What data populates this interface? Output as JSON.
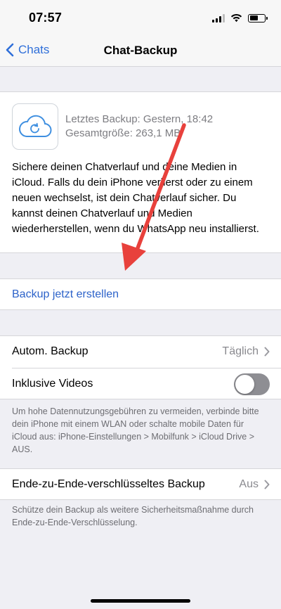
{
  "status": {
    "time": "07:57"
  },
  "nav": {
    "back_label": "Chats",
    "title": "Chat-Backup"
  },
  "backup": {
    "last_backup": "Letztes Backup: Gestern, 18:42",
    "total_size": "Gesamtgröße: 263,1 MB",
    "description": "Sichere deinen Chatverlauf und deine Medien in iCloud. Falls du dein iPhone verlierst oder zu einem neuen wechselst, ist dein Chatverlauf sicher. Du kannst deinen Chatverlauf und Medien wiederherstellen, wenn du WhatsApp neu installierst."
  },
  "action": {
    "backup_now": "Backup jetzt erstellen"
  },
  "settings": {
    "auto_backup_label": "Autom. Backup",
    "auto_backup_value": "Täglich",
    "include_videos_label": "Inklusive Videos",
    "include_videos_on": false,
    "footnote": "Um hohe Datennutzungsgebühren zu vermeiden, verbinde bitte dein iPhone mit einem WLAN oder schalte mobile Daten für iCloud aus: iPhone-Einstellungen > Mobilfunk > iCloud Drive > AUS."
  },
  "e2e": {
    "label": "Ende-zu-Ende-verschlüsseltes Backup",
    "value": "Aus",
    "footnote": "Schütze dein Backup als weitere Sicherheitsmaßnahme durch Ende-zu-Ende-Verschlüsselung."
  },
  "colors": {
    "accent": "#2c62c9",
    "annotation_arrow": "#e8413c"
  },
  "icons": [
    "chevron-left-icon",
    "cloud-sync-icon",
    "chevron-right-icon",
    "signal-icon",
    "wifi-icon",
    "battery-icon"
  ]
}
